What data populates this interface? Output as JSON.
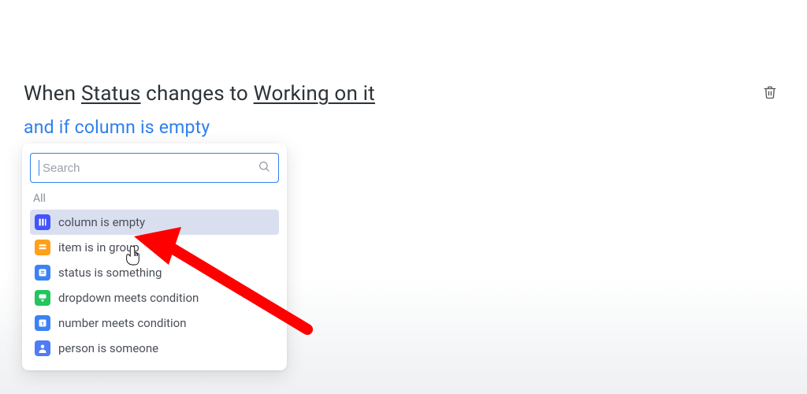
{
  "sentence": {
    "prefix": "When ",
    "token1": "Status",
    "middle": " changes to ",
    "token2": "Working on it"
  },
  "subline": "and if column is empty",
  "search": {
    "placeholder": "Search",
    "value": ""
  },
  "section_label": "All",
  "options": [
    {
      "label": "column is empty",
      "icon": "column-icon",
      "icon_color": "ic-indigo",
      "hovered": true
    },
    {
      "label": "item is in group",
      "icon": "item-icon",
      "icon_color": "ic-orange",
      "hovered": false
    },
    {
      "label": "status is something",
      "icon": "status-icon",
      "icon_color": "ic-blue",
      "hovered": false
    },
    {
      "label": "dropdown meets condition",
      "icon": "dropdown-icon",
      "icon_color": "ic-green",
      "hovered": false
    },
    {
      "label": "number meets condition",
      "icon": "number-icon",
      "icon_color": "ic-blue2",
      "hovered": false
    },
    {
      "label": "person is someone",
      "icon": "person-icon",
      "icon_color": "ic-person",
      "hovered": false
    }
  ],
  "annotation": {
    "arrow_color": "#ff0000"
  }
}
